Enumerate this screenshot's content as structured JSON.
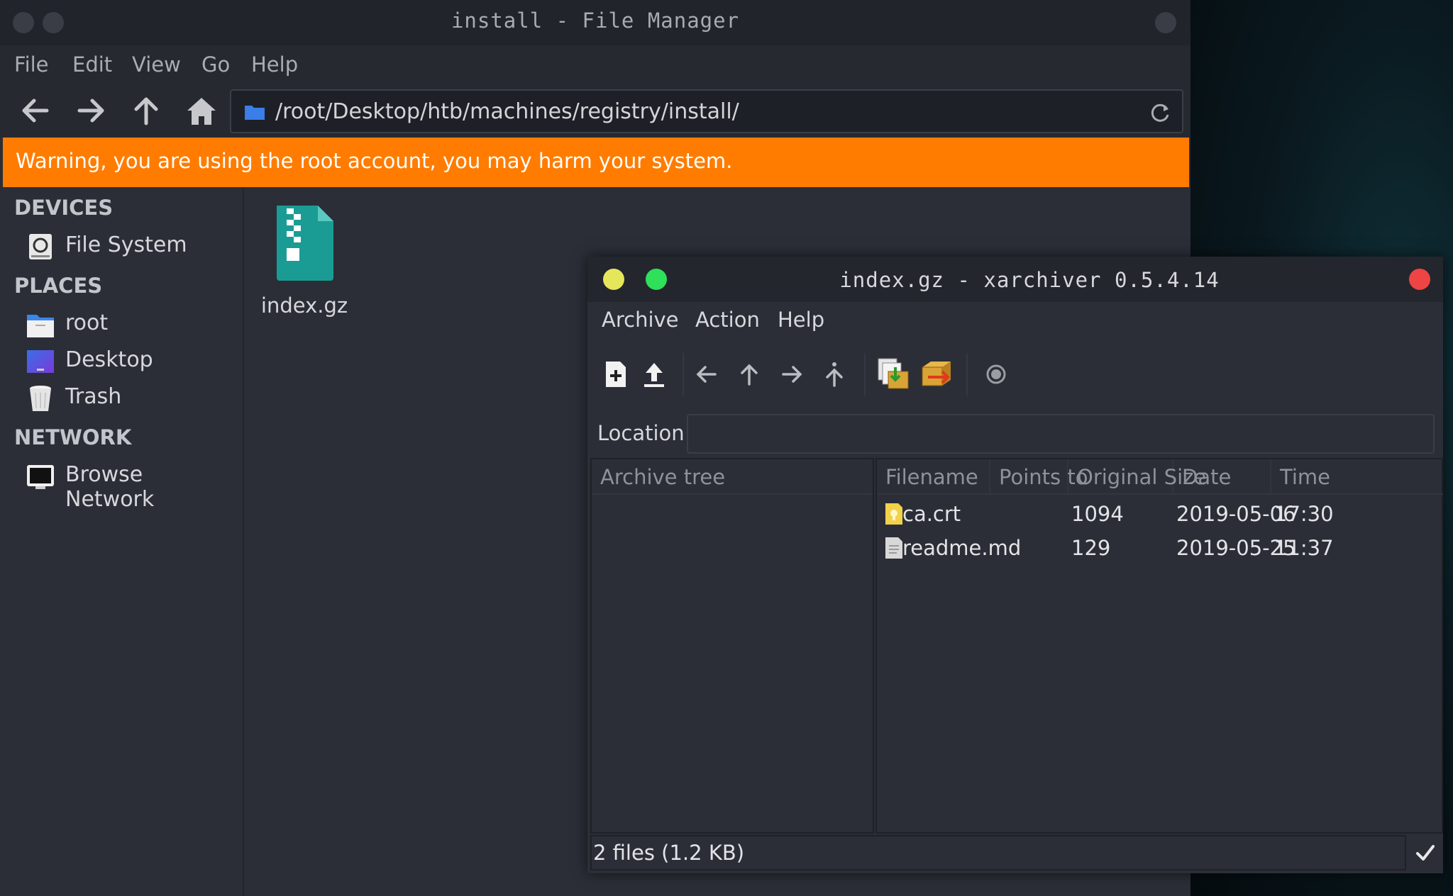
{
  "file_manager": {
    "title": "install - File Manager",
    "menu": [
      "File",
      "Edit",
      "View",
      "Go",
      "Help"
    ],
    "path": "/root/Desktop/htb/machines/registry/install/",
    "warning": "Warning, you are using the root account, you may harm your system.",
    "sidebar": {
      "devices_heading": "DEVICES",
      "devices": [
        {
          "label": "File System",
          "icon": "drive-icon"
        }
      ],
      "places_heading": "PLACES",
      "places": [
        {
          "label": "root",
          "icon": "home-folder-icon"
        },
        {
          "label": "Desktop",
          "icon": "desktop-icon"
        },
        {
          "label": "Trash",
          "icon": "trash-icon"
        }
      ],
      "network_heading": "NETWORK",
      "network": [
        {
          "label": "Browse Network",
          "icon": "network-icon"
        }
      ]
    },
    "files": [
      {
        "name": "index.gz",
        "icon": "archive-file-icon"
      }
    ],
    "colors": {
      "warning": "#ff7c00",
      "background": "#2b2e37"
    }
  },
  "xarchiver": {
    "title": "index.gz - xarchiver 0.5.4.14",
    "menu": [
      "Archive",
      "Action",
      "Help"
    ],
    "location_label": "Location:",
    "location_value": "",
    "tree_header": "Archive tree",
    "columns": [
      "Filename",
      "Points to",
      "Original Size",
      "Date",
      "Time"
    ],
    "rows": [
      {
        "filename": "ca.crt",
        "points_to": "",
        "size": "1094",
        "date": "2019-05-06",
        "time": "17:30",
        "icon": "certificate-file-icon"
      },
      {
        "filename": "readme.md",
        "points_to": "",
        "size": "129",
        "date": "2019-05-25",
        "time": "11:37",
        "icon": "text-file-icon"
      }
    ],
    "status": "2 files  (1.2 KB)",
    "colors": {
      "minimize": "#e6e65a",
      "maximize": "#2ee05a",
      "close": "#ee4444"
    }
  }
}
